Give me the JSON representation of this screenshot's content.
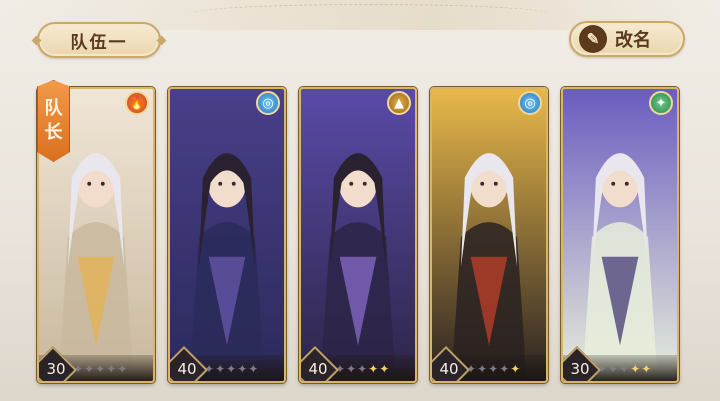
{
  "header": {
    "team_name": "队伍一",
    "rename_label": "改名",
    "rename_icon": "brush-icon"
  },
  "captain_badge": [
    "队",
    "长"
  ],
  "cards": [
    {
      "level": "30",
      "element": "fire",
      "element_icon": "flame-icon",
      "stars_lit": 0,
      "stars_total": 5,
      "palette": [
        "#f0e6d6",
        "#c9b89e",
        "#e7b04a"
      ]
    },
    {
      "level": "40",
      "element": "water",
      "element_icon": "swirl-icon",
      "stars_lit": 0,
      "stars_total": 5,
      "palette": [
        "#4a3f8a",
        "#2a2a5a",
        "#6b5bb0"
      ]
    },
    {
      "level": "40",
      "element": "earth",
      "element_icon": "mountain-icon",
      "stars_lit": 2,
      "stars_total": 5,
      "palette": [
        "#5a4aa8",
        "#2d2548",
        "#8b6fd0"
      ]
    },
    {
      "level": "40",
      "element": "water",
      "element_icon": "swirl-icon",
      "stars_lit": 1,
      "stars_total": 5,
      "palette": [
        "#e8b84a",
        "#2a2222",
        "#c9402a"
      ]
    },
    {
      "level": "30",
      "element": "wind",
      "element_icon": "leaf-icon",
      "stars_lit": 2,
      "stars_total": 5,
      "palette": [
        "#6a5cc0",
        "#e8eedb",
        "#3b2f70"
      ]
    }
  ]
}
